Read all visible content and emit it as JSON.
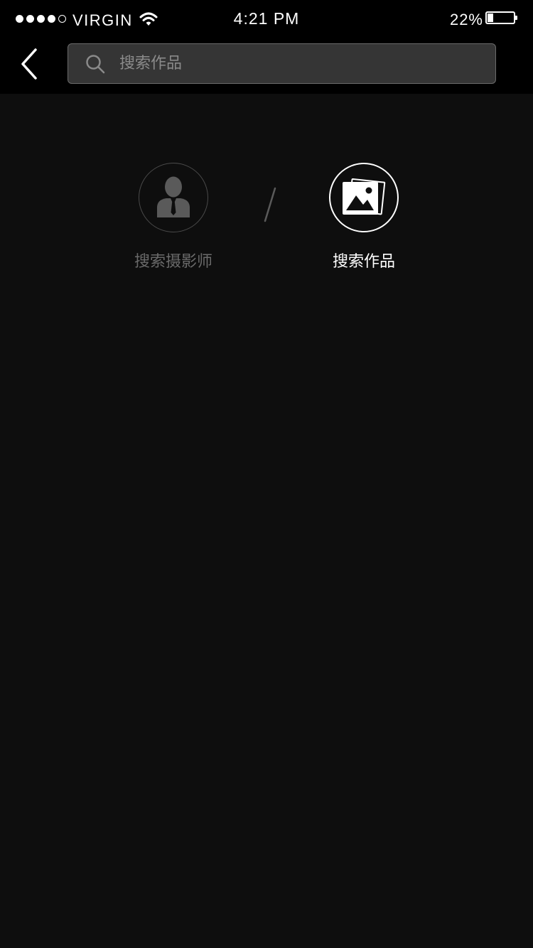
{
  "status_bar": {
    "carrier": "VIRGIN",
    "time": "4:21 PM",
    "battery_percent": "22%",
    "battery_level": 0.22,
    "signal_bars_filled": 4,
    "signal_bars_total": 5
  },
  "nav": {
    "back_icon": "chevron-left-icon",
    "search": {
      "placeholder": "搜索作品",
      "value": "",
      "icon": "search-icon"
    }
  },
  "search_modes": [
    {
      "label": "搜索摄影师",
      "icon": "person-suit-icon",
      "selected": false
    },
    {
      "label": "搜索作品",
      "icon": "photos-icon",
      "selected": true
    }
  ],
  "colors": {
    "background": "#0e0e0e",
    "bar_background": "#000000",
    "search_field": "#353535",
    "inactive": "#6a6a6a",
    "active": "#ffffff"
  }
}
